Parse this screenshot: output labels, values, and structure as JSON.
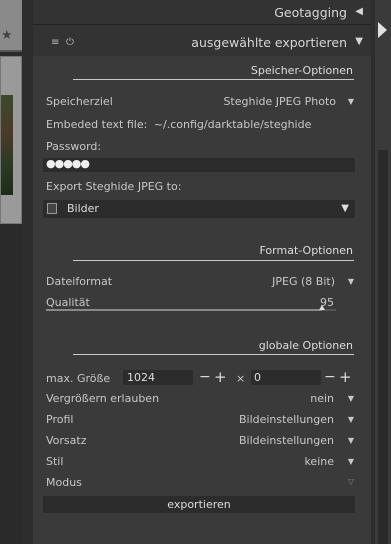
{
  "headers": {
    "geotagging": "Geotagging",
    "export": "ausgewählte exportieren"
  },
  "storage": {
    "section_title": "Speicher-Optionen",
    "target_label": "Speicherziel",
    "target_value": "Steghide JPEG Photo",
    "embedded_label": "Embeded text file:",
    "embedded_value": "~/.config/darktable/steghide",
    "password_label": "Password:",
    "password_value": "●●●●●",
    "export_to_label": "Export Steghide JPEG to:",
    "export_to_value": "Bilder"
  },
  "format": {
    "section_title": "Format-Optionen",
    "file_format_label": "Dateiformat",
    "file_format_value": "JPEG (8 Bit)",
    "quality_label": "Qualität",
    "quality_value": "95",
    "quality_percent": 95
  },
  "global": {
    "section_title": "globale Optionen",
    "max_size_label": "max. Größe",
    "max_width": "1024",
    "times": "×",
    "max_height": "0",
    "upscale_label": "Vergrößern erlauben",
    "upscale_value": "nein",
    "profile_label": "Profil",
    "profile_value": "Bildeinstellungen",
    "intent_label": "Vorsatz",
    "intent_value": "Bildeinstellungen",
    "style_label": "Stil",
    "style_value": "keine",
    "mode_label": "Modus"
  },
  "export_button": "exportieren",
  "icons": {
    "collapse": "triangle-left-icon",
    "expand": "triangle-down-icon",
    "presets": "hamburger-icon",
    "reset": "reset-icon",
    "folder": "folder-icon",
    "star": "star-icon"
  },
  "colors": {
    "panel_bg": "#333333",
    "body_bg": "#3a3a3a",
    "field_bg": "#2c2c2c",
    "text": "#c8c8c8"
  }
}
